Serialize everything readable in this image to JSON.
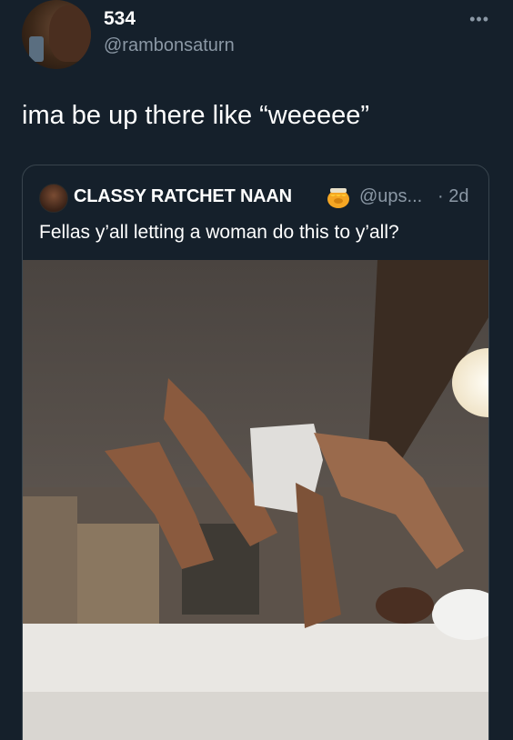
{
  "tweet": {
    "display_name": "534",
    "handle": "@rambonsaturn",
    "more_icon": "more-horizontal-icon",
    "more_glyph": "•••",
    "text": "ima be up there like “weeeee”"
  },
  "quoted_tweet": {
    "display_name": "CLASSY RATCHET NAAN",
    "name_emoji": "honey-pot-icon",
    "handle": "@ups...",
    "time": "· 2d",
    "text": "Fellas y’all letting a woman do this to y’all?",
    "media_icon": "photo-icon"
  },
  "colors": {
    "background": "#15202b",
    "border": "#38444d",
    "secondary_text": "#8b98a5",
    "primary_text": "#ffffff"
  }
}
